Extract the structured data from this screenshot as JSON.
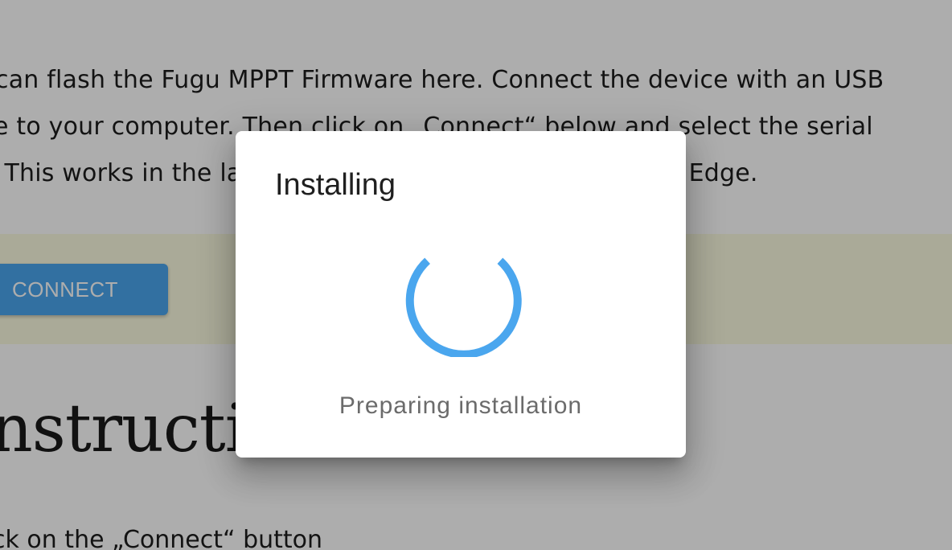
{
  "intro": {
    "line1": "can flash the Fugu MPPT Firmware here. Connect the device with an USB",
    "line2": "e to your computer. Then click on „Connect“ below and select the serial",
    "line3": ". This works in the latest versions of Google Chrome and Edge."
  },
  "connect_button": {
    "label": "CONNECT"
  },
  "instructions": {
    "heading": "nstructions",
    "step1": "ck on the „Connect“ button"
  },
  "dialog": {
    "title": "Installing",
    "status": "Preparing installation",
    "spinner_icon": "progress-spinner-icon"
  },
  "colors": {
    "accent": "#4aa6ee",
    "band": "#fbfbe0",
    "scrim": "rgba(0,0,0,0.32)"
  }
}
